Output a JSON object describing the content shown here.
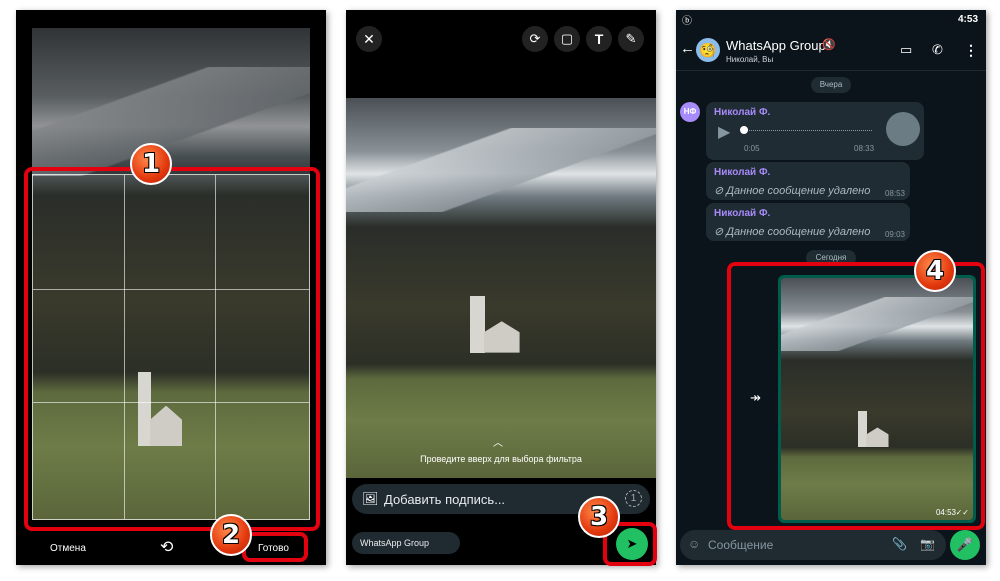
{
  "step_numbers": [
    "1",
    "2",
    "3",
    "4"
  ],
  "crop_screen": {
    "cancel_label": "Отмена",
    "done_label": "Готово",
    "rotate_icon": "rotate-icon"
  },
  "editor_screen": {
    "tools": [
      "crop-rotate-icon",
      "sticker-icon",
      "text-icon",
      "pencil-icon"
    ],
    "filter_hint": "Проведите вверх для выбора фильтра",
    "caption_placeholder": "Добавить подпись...",
    "recipient": "WhatsApp Group",
    "view_once": "1"
  },
  "chat_screen": {
    "status_time": "4:53",
    "title": "WhatsApp Group",
    "subtitle": "Николай, Вы",
    "date_yesterday": "Вчера",
    "date_today": "Сегодня",
    "avatar_initials": "НФ",
    "messages": [
      {
        "sender": "Николай Ф.",
        "type": "voice",
        "elapsed": "0:05",
        "time": "08:33"
      },
      {
        "sender": "Николай Ф.",
        "text": "Данное сообщение удалено",
        "time": "08:53"
      },
      {
        "sender": "Николай Ф.",
        "text": "Данное сообщение удалено",
        "time": "09:03"
      }
    ],
    "image_message_time": "04:53",
    "input_placeholder": "Сообщение"
  },
  "colors": {
    "accent_green": "#21c063",
    "highlight_red": "#e3000f",
    "sender_purple": "#a78bfa"
  }
}
